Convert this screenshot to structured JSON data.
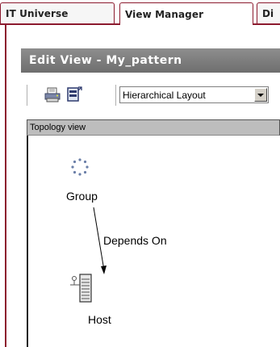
{
  "tabs": [
    {
      "label": "IT Universe",
      "active": false
    },
    {
      "label": "View Manager",
      "active": true
    },
    {
      "label": "Di",
      "active": false
    }
  ],
  "panel": {
    "title": "Edit View - My_pattern"
  },
  "toolbar": {
    "icons": [
      "print-icon",
      "layout-options-icon"
    ],
    "layout_select": {
      "value": "Hierarchical Layout"
    }
  },
  "topology": {
    "header": "Topology view",
    "nodes": [
      {
        "label": "Group",
        "icon": "group-icon"
      },
      {
        "label": "Host",
        "icon": "host-icon"
      }
    ],
    "edges": [
      {
        "label": "Depends On",
        "from": "Group",
        "to": "Host"
      }
    ]
  },
  "colors": {
    "accent": "#8c1a2e",
    "panel_header": "#7a7a7a",
    "topology_header": "#bdbdbd"
  }
}
